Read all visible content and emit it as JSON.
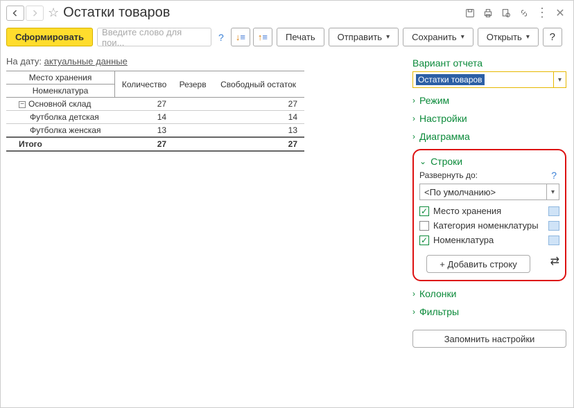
{
  "title": "Остатки товаров",
  "search_placeholder": "Введите слово для пои...",
  "toolbar": {
    "generate": "Сформировать",
    "print": "Печать",
    "send": "Отправить",
    "save": "Сохранить",
    "open": "Открыть"
  },
  "date_line": {
    "prefix": "На дату:",
    "value": "актуальные данные"
  },
  "table": {
    "header_group1": "Место хранения",
    "header_group2": "Номенклатура",
    "col_qty": "Количество",
    "col_reserve": "Резерв",
    "col_free": "Свободный остаток",
    "group_name": "Основной склад",
    "group_qty": "27",
    "group_free": "27",
    "rows": [
      {
        "name": "Футболка детская",
        "qty": "14",
        "free": "14"
      },
      {
        "name": "Футболка женская",
        "qty": "13",
        "free": "13"
      }
    ],
    "total_label": "Итого",
    "total_qty": "27",
    "total_free": "27"
  },
  "right": {
    "variant_title": "Вариант отчета",
    "variant_value": "Остатки товаров",
    "sections": {
      "mode": "Режим",
      "settings": "Настройки",
      "diagram": "Диаграмма",
      "rows": "Строки",
      "columns": "Колонки",
      "filters": "Фильтры"
    },
    "rows_panel": {
      "expand_label": "Развернуть до:",
      "combo_value": "<По умолчанию>",
      "items": [
        {
          "label": "Место хранения",
          "checked": true
        },
        {
          "label": "Категория номенклатуры",
          "checked": false
        },
        {
          "label": "Номенклатура",
          "checked": true
        }
      ],
      "add_row": "+ Добавить строку"
    },
    "remember": "Запомнить настройки"
  }
}
